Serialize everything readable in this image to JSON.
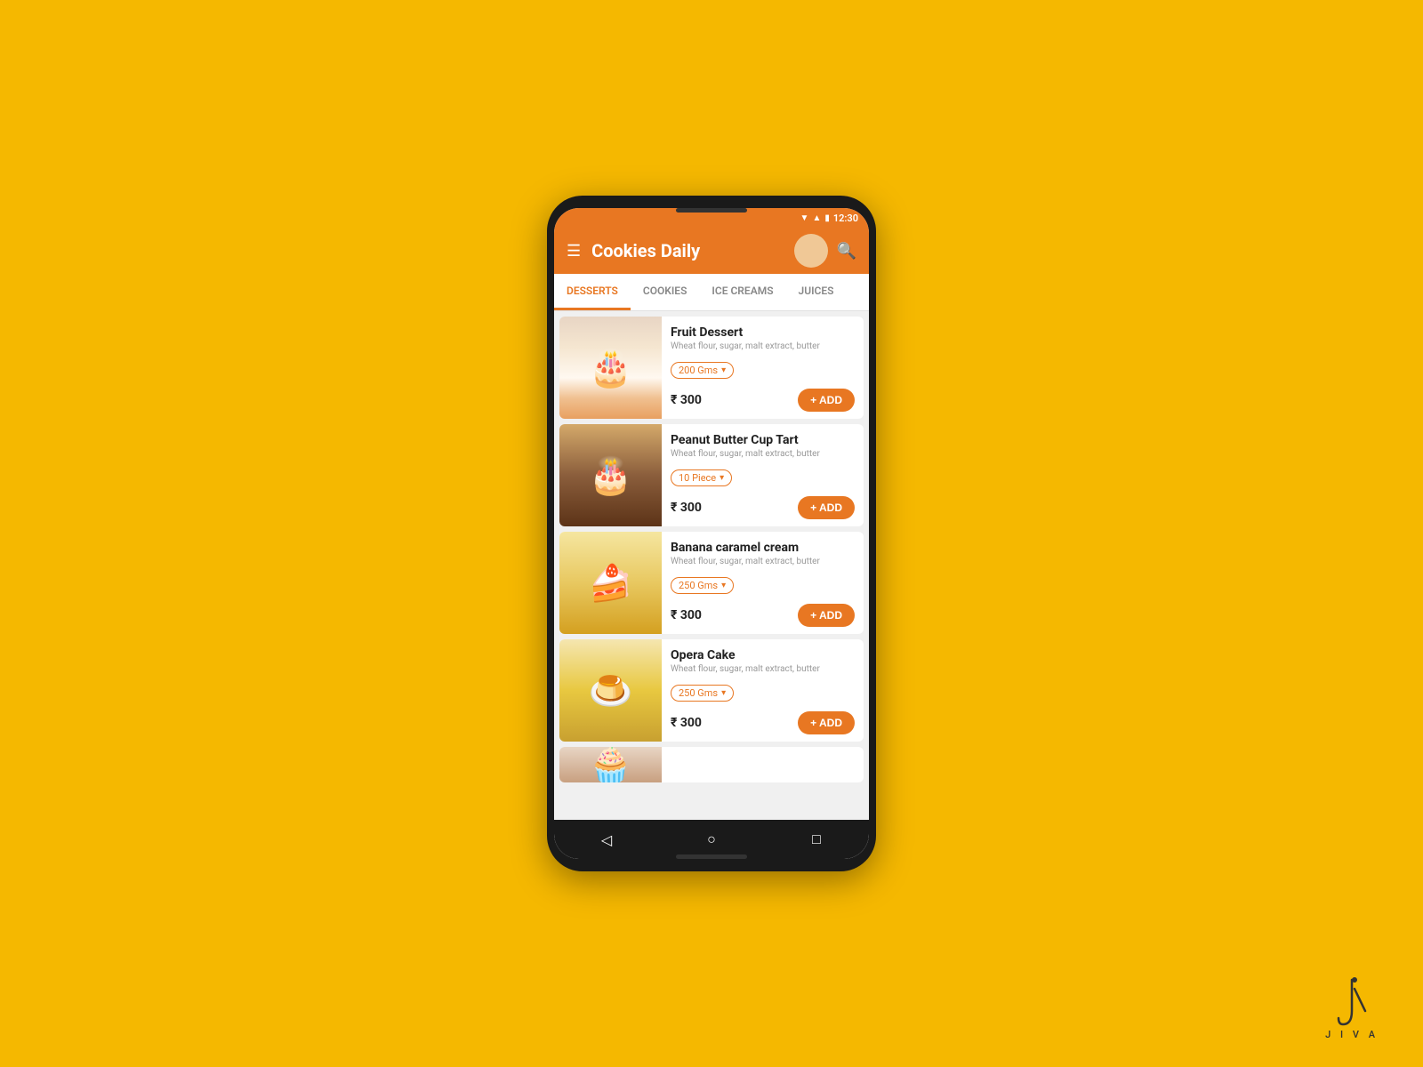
{
  "background": "#F5B800",
  "status_bar": {
    "time": "12:30"
  },
  "header": {
    "title": "Cookies Daily",
    "menu_icon": "☰",
    "search_icon": "🔍"
  },
  "tabs": [
    {
      "label": "DESSERTS",
      "active": true
    },
    {
      "label": "COOKIES",
      "active": false
    },
    {
      "label": "ICE CREAMS",
      "active": false
    },
    {
      "label": "JUICES",
      "active": false
    }
  ],
  "products": [
    {
      "name": "Fruit Dessert",
      "desc": "Wheat flour, sugar, malt extract, butter",
      "size": "200 Gms",
      "price": "₹ 300",
      "add_label": "+ ADD",
      "img_class": "img-fruit-dessert"
    },
    {
      "name": "Peanut Butter Cup Tart",
      "desc": "Wheat flour, sugar, malt extract, butter",
      "size": "10 Piece",
      "price": "₹ 300",
      "add_label": "+ ADD",
      "img_class": "img-peanut"
    },
    {
      "name": "Banana caramel cream",
      "desc": "Wheat flour, sugar, malt extract, butter",
      "size": "250 Gms",
      "price": "₹ 300",
      "add_label": "+ ADD",
      "img_class": "img-banana"
    },
    {
      "name": "Opera Cake",
      "desc": "Wheat flour, sugar, malt extract, butter",
      "size": "250 Gms",
      "price": "₹ 300",
      "add_label": "+ ADD",
      "img_class": "img-opera"
    }
  ],
  "bottom_nav": {
    "back": "◁",
    "home": "○",
    "recents": "□"
  },
  "watermark": {
    "text": "J I V A"
  }
}
